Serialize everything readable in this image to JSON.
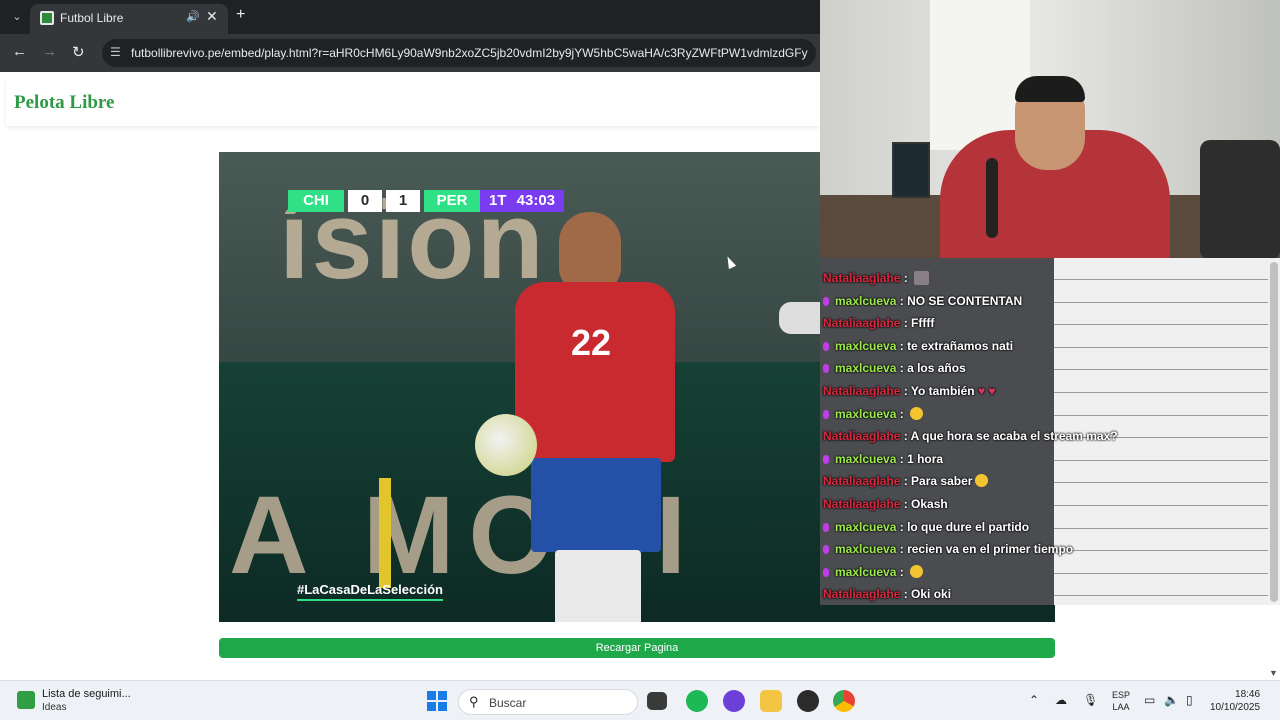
{
  "browser": {
    "tab_title": "Futbol Libre",
    "url": "futbollibrevivo.pe/embed/play.html?r=aHR0cHM6Ly90aW9nb2xoZC5jb20vdmI2by9jYW5hbC5waHA/c3RyZWFtPW1vdmlzdGFy"
  },
  "page": {
    "logo_text": "Pelota Libre",
    "reload_label": "Recargar Pagina"
  },
  "video": {
    "scoreboard": {
      "home": "CHI",
      "home_score": "0",
      "away_score": "1",
      "away": "PER",
      "period": "1T",
      "clock": "43:03"
    },
    "jersey_number": "22",
    "hashtag": "#LaCasaDeLaSelección",
    "colors": {
      "accent_green": "#2fe087",
      "accent_purple": "#7a3cf0"
    }
  },
  "chat": {
    "colors": {
      "maxlcueva": "#9dea4a",
      "nataliaaglahe": "#d8283e",
      "mic_badge": "#c03ee6"
    },
    "messages": [
      {
        "user": "Nataliaaglahe",
        "text": "",
        "extra": "sticker"
      },
      {
        "user": "maxlcueva",
        "text": "NO SE CONTENTAN",
        "extra": ""
      },
      {
        "user": "Nataliaaglahe",
        "text": "Fffff",
        "extra": ""
      },
      {
        "user": "maxlcueva",
        "text": "te extrañamos nati",
        "extra": ""
      },
      {
        "user": "maxlcueva",
        "text": "a los años",
        "extra": ""
      },
      {
        "user": "Nataliaaglahe",
        "text": "Yo también",
        "extra": "hearts"
      },
      {
        "user": "maxlcueva",
        "text": "",
        "extra": "emoji"
      },
      {
        "user": "Nataliaaglahe",
        "text": "A que hora se acaba el stream max?",
        "extra": ""
      },
      {
        "user": "maxlcueva",
        "text": "1 hora",
        "extra": ""
      },
      {
        "user": "Nataliaaglahe",
        "text": "Para saber",
        "extra": "heart-emoji"
      },
      {
        "user": "Nataliaaglahe",
        "text": "Okash",
        "extra": ""
      },
      {
        "user": "maxlcueva",
        "text": "lo que dure el partido",
        "extra": ""
      },
      {
        "user": "maxlcueva",
        "text": "recien va en el primer tiempo",
        "extra": ""
      },
      {
        "user": "maxlcueva",
        "text": "",
        "extra": "emoji"
      },
      {
        "user": "Nataliaaglahe",
        "text": "Oki oki",
        "extra": ""
      }
    ]
  },
  "taskbar": {
    "widget_title": "Lista de seguimi...",
    "widget_sub": "Ideas",
    "search_placeholder": "Buscar",
    "language_top": "ESP",
    "language_bottom": "LAA",
    "time": "18:46",
    "date": "10/10/2025"
  }
}
